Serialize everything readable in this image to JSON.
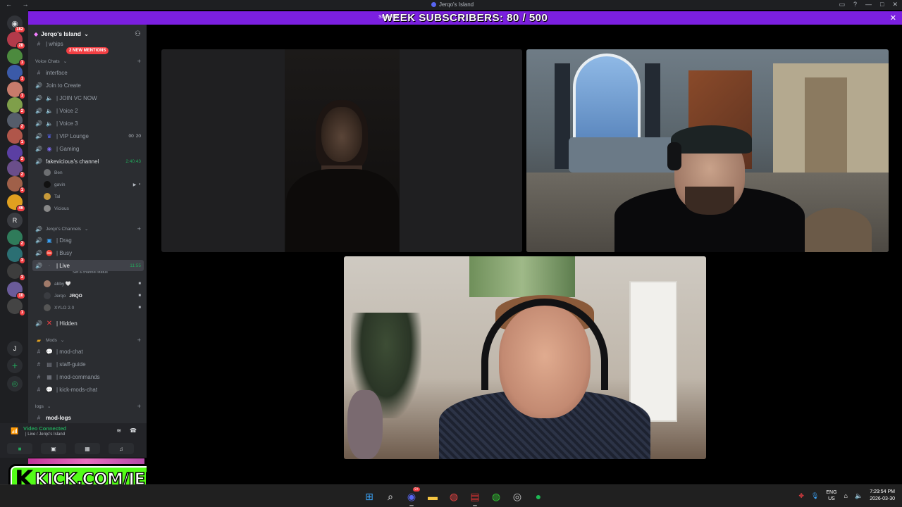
{
  "window": {
    "title": "Jerqo's Island",
    "nav_back": "←",
    "nav_forward": "→",
    "controls": {
      "inbox": "▭",
      "help": "?",
      "minimize": "—",
      "maximize": "□",
      "close": "✕"
    }
  },
  "banner": {
    "text": "WEEK SUBSCRIBERS: 80 / 500",
    "streamer_text": "Streamer",
    "close": "✕"
  },
  "server_rail": {
    "home_icon": "◉",
    "home_badge": "182",
    "servers": [
      {
        "color": "#b33a4a",
        "badge": "28"
      },
      {
        "color": "#4c8a3e",
        "badge": "1"
      },
      {
        "color": "#3b5aa8",
        "badge": "1"
      },
      {
        "color": "#c77b6b",
        "badge": "1"
      },
      {
        "color": "#7f9f4a",
        "badge": "2"
      },
      {
        "color": "#555d6b",
        "badge": "2"
      },
      {
        "color": "#b0564a",
        "badge": "1"
      },
      {
        "color": "#5b3fa3",
        "badge": "3"
      },
      {
        "color": "#6a4e8a",
        "badge": "2"
      },
      {
        "color": "#a06049",
        "badge": "1"
      },
      {
        "color": "#e0a020",
        "badge": "46"
      },
      {
        "color": "#3a3c41",
        "badge": ""
      },
      {
        "color": "#2f7b5a",
        "badge": "2"
      },
      {
        "color": "#2b6f73",
        "badge": "3"
      },
      {
        "color": "#3d3d3d",
        "badge": "3"
      },
      {
        "color": "#6a5b9a",
        "badge": "10"
      },
      {
        "color": "#444",
        "badge": "1"
      }
    ],
    "r_server_letter": "R",
    "j_server_letter": "J",
    "add_server": "+",
    "discover": "◎"
  },
  "sidebar": {
    "server_name": "Jerqo's Island",
    "mentions_pill": "2 NEW MENTIONS",
    "partial_channel": "| whips",
    "categories": {
      "voice_chats": "Voice Chats",
      "jerqos_channels": "Jerqo's Channels",
      "mods": "Mods",
      "logs": "logs"
    },
    "voice_channels": [
      {
        "name": "interface",
        "type": "text"
      },
      {
        "name": "Join to Create",
        "type": "voice"
      },
      {
        "name": "| JOIN VC NOW",
        "type": "voice"
      },
      {
        "name": "| Voice 2",
        "type": "voice"
      },
      {
        "name": "| Voice 3",
        "type": "voice"
      },
      {
        "name": "| VIP Lounge",
        "type": "voice",
        "count_a": "00",
        "count_b": "20"
      },
      {
        "name": "| Gaming",
        "type": "voice"
      },
      {
        "name": "fakevicious's channel",
        "type": "voice",
        "timer": "2:40:43"
      }
    ],
    "fake_members": [
      "Ben",
      "gavin",
      "Tal",
      "Vicious"
    ],
    "jerqo_channels": [
      {
        "name": "| Drag"
      },
      {
        "name": "| Busy"
      },
      {
        "name": "| Live",
        "timer": "11:55",
        "status": "Set a channel status"
      }
    ],
    "live_members": [
      "abby 🤍",
      "Jerqo",
      "XYLO 2.0"
    ],
    "jerqo_tag": "JRQO",
    "hidden_channel": "| Hidden",
    "mod_channels": [
      "| mod-chat",
      "| staff-guide",
      "| mod-commands",
      "| kick-mods-chat"
    ],
    "log_channels": [
      "mod-logs"
    ]
  },
  "voice_panel": {
    "status": "Video Connected",
    "location": "| Live / Jerqo's Island"
  },
  "overlay": {
    "k": "K",
    "url": "KICK.COM/JERQO"
  },
  "taskbar": {
    "discord_badge": "9+",
    "lang_top": "ENG",
    "lang_bottom": "US",
    "time": "7:29:54 PM",
    "date": "2026-03-30"
  }
}
